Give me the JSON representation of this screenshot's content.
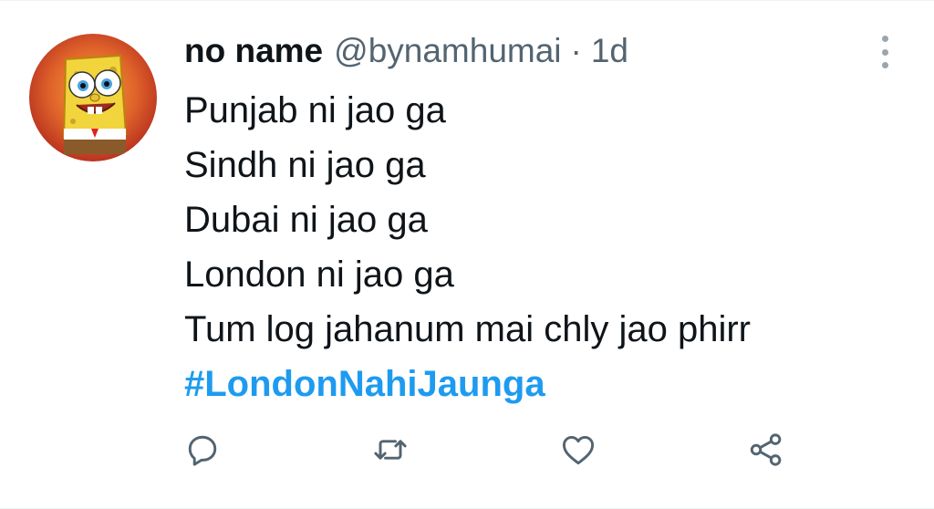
{
  "tweet": {
    "author_name": "no name",
    "handle": "@bynamhumai",
    "separator": "·",
    "time": "1d",
    "lines": [
      "Punjab ni jao ga",
      "Sindh ni jao ga",
      "Dubai ni jao ga",
      "London ni jao ga",
      "Tum log jahanum mai chly jao phirr"
    ],
    "hashtag": "#LondonNahiJaunga"
  },
  "icons": {
    "avatar": "spongebob-avatar",
    "more": "more-vertical-icon",
    "reply": "reply-icon",
    "retweet": "retweet-icon",
    "like": "heart-icon",
    "share": "share-icon"
  },
  "colors": {
    "text": "#0f1419",
    "secondary": "#536471",
    "hashtag": "#1d9bf0",
    "icon": "#536471"
  }
}
